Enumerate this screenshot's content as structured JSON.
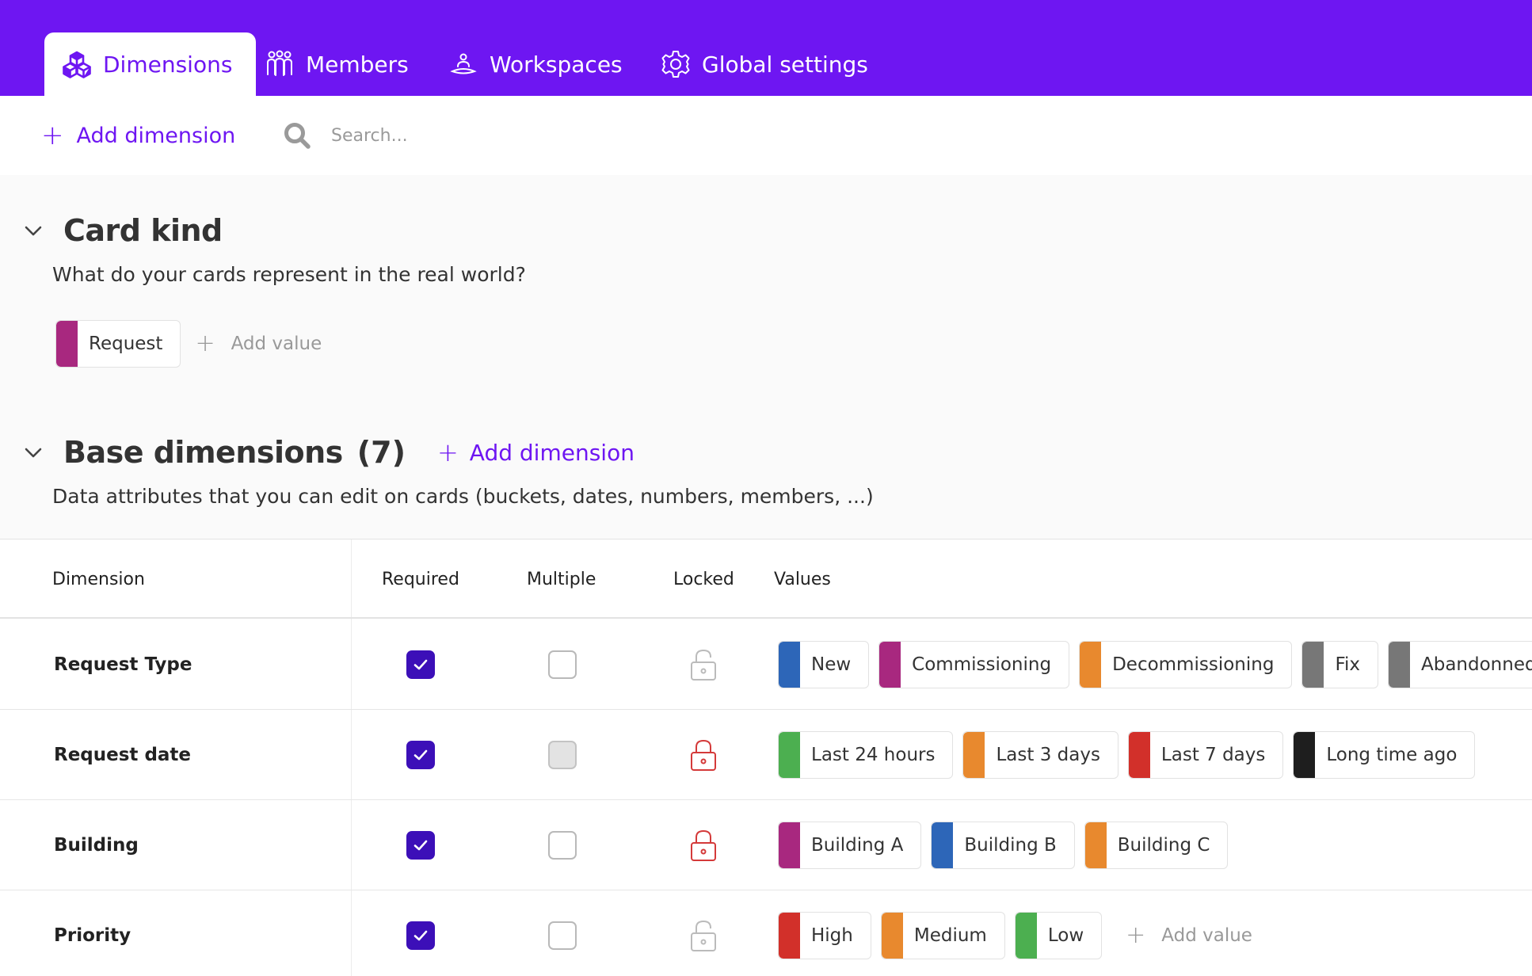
{
  "colors": {
    "accent": "#6e16f2",
    "checkbox_on": "#3c0fb8",
    "lock_red": "#d43a3a",
    "lock_grey": "#bbbbbb",
    "magenta": "#a8287f",
    "blue": "#2d66b8",
    "orange": "#e8892e",
    "grey": "#777777",
    "green": "#4caf50",
    "red": "#d2302a",
    "black": "#1e1e1e"
  },
  "nav": {
    "tabs": [
      {
        "label": "Dimensions",
        "icon": "cubes-icon",
        "active": true
      },
      {
        "label": "Members",
        "icon": "people-icon",
        "active": false
      },
      {
        "label": "Workspaces",
        "icon": "workspace-icon",
        "active": false
      },
      {
        "label": "Global settings",
        "icon": "gear-icon",
        "active": false
      }
    ]
  },
  "toolbar": {
    "add_dimension": "Add dimension",
    "search_placeholder": "Search..."
  },
  "card_kind": {
    "title": "Card kind",
    "description": "What do your cards represent in the real world?",
    "values": [
      {
        "label": "Request",
        "color": "#a8287f"
      }
    ],
    "add_value": "Add value"
  },
  "base": {
    "title": "Base dimensions",
    "count": "(7)",
    "add_dimension": "Add dimension",
    "description": "Data attributes that you can edit on cards (buckets, dates, numbers, members, ...)"
  },
  "table": {
    "headers": {
      "dimension": "Dimension",
      "required": "Required",
      "multiple": "Multiple",
      "locked": "Locked",
      "values": "Values"
    },
    "rows": [
      {
        "name": "Request Type",
        "required": true,
        "multiple": "off",
        "locked": false,
        "values": [
          {
            "label": "New",
            "color": "#2d66b8"
          },
          {
            "label": "Commissioning",
            "color": "#a8287f"
          },
          {
            "label": "Decommissioning",
            "color": "#e8892e"
          },
          {
            "label": "Fix",
            "color": "#777777"
          },
          {
            "label": "Abandonned",
            "color": "#777777"
          }
        ]
      },
      {
        "name": "Request date",
        "required": true,
        "multiple": "disabled",
        "locked": true,
        "values": [
          {
            "label": "Last 24 hours",
            "color": "#4caf50"
          },
          {
            "label": "Last 3 days",
            "color": "#e8892e"
          },
          {
            "label": "Last 7 days",
            "color": "#d2302a"
          },
          {
            "label": "Long time ago",
            "color": "#1e1e1e"
          }
        ]
      },
      {
        "name": "Building",
        "required": true,
        "multiple": "off",
        "locked": true,
        "values": [
          {
            "label": "Building A",
            "color": "#a8287f"
          },
          {
            "label": "Building B",
            "color": "#2d66b8"
          },
          {
            "label": "Building C",
            "color": "#e8892e"
          }
        ]
      },
      {
        "name": "Priority",
        "required": true,
        "multiple": "off",
        "locked": false,
        "values": [
          {
            "label": "High",
            "color": "#d2302a"
          },
          {
            "label": "Medium",
            "color": "#e8892e"
          },
          {
            "label": "Low",
            "color": "#4caf50"
          }
        ],
        "add_value": "Add value"
      }
    ]
  }
}
